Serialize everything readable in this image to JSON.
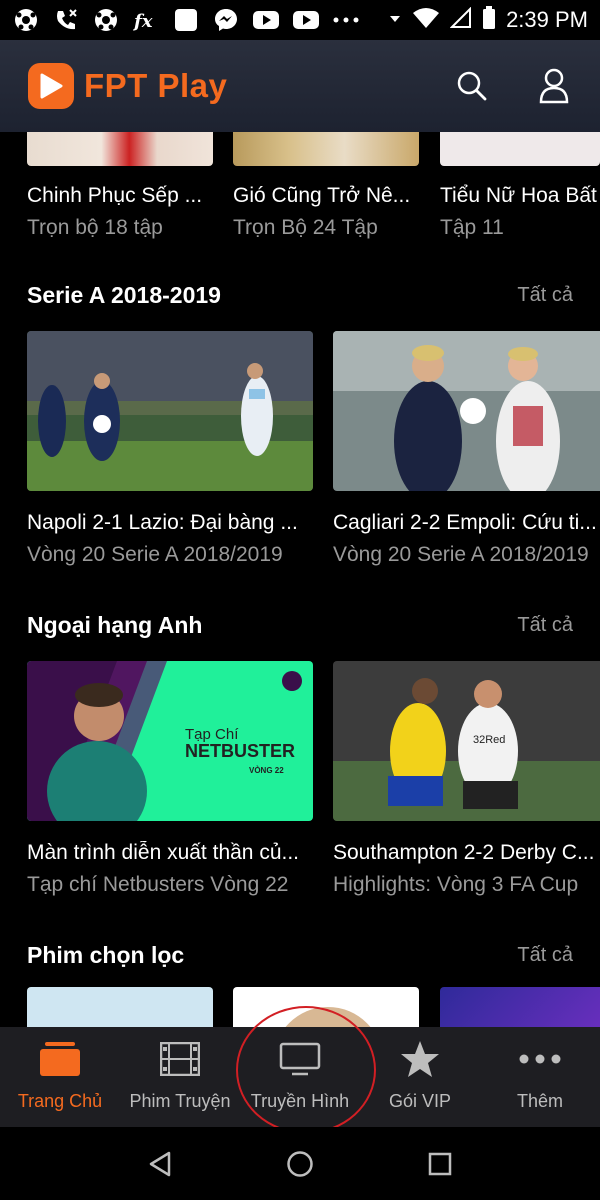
{
  "status_bar": {
    "time": "2:39 PM"
  },
  "app": {
    "logo_text": "FPT Play"
  },
  "top_row": [
    {
      "title": "Chinh Phục Sếp ...",
      "subtitle": "Trọn bộ 18 tập"
    },
    {
      "title": "Gió Cũng Trở Nê...",
      "subtitle": "Trọn Bộ 24 Tập"
    },
    {
      "title": "Tiểu Nữ Hoa Bất",
      "subtitle": "Tập 11"
    }
  ],
  "sections": [
    {
      "title": "Serie A 2018-2019",
      "all_label": "Tất cả",
      "cards": [
        {
          "title": "Napoli 2-1 Lazio: Đại bàng ...",
          "subtitle": "Vòng 20 Serie A 2018/2019"
        },
        {
          "title": "Cagliari 2-2 Empoli: Cứu ti...",
          "subtitle": "Vòng 20 Serie A 2018/2019"
        }
      ]
    },
    {
      "title": "Ngoại hạng Anh",
      "all_label": "Tất cả",
      "cards": [
        {
          "title": "Màn trình diễn xuất thần củ...",
          "subtitle": "Tạp chí Netbusters Vòng 22",
          "thumb_text_1": "Tạp Chí",
          "thumb_text_2": "NETBUSTER",
          "thumb_text_3": "VÒNG 22"
        },
        {
          "title": "Southampton 2-2 Derby C...",
          "subtitle": "Highlights: Vòng 3 FA Cup",
          "thumb_text_1": "32Red"
        }
      ]
    },
    {
      "title": "Phim chọn lọc",
      "all_label": "Tất cả"
    }
  ],
  "bottom_nav": [
    {
      "label": "Trang Chủ",
      "icon": "home-icon",
      "active": true
    },
    {
      "label": "Phim Truyện",
      "icon": "film-icon"
    },
    {
      "label": "Truyền Hình",
      "icon": "tv-icon"
    },
    {
      "label": "Gói VIP",
      "icon": "star-icon"
    },
    {
      "label": "Thêm",
      "icon": "more-icon"
    }
  ],
  "colors": {
    "accent": "#f46a1f",
    "annotation": "#d21f24",
    "nav_bg": "#1e1e22"
  }
}
